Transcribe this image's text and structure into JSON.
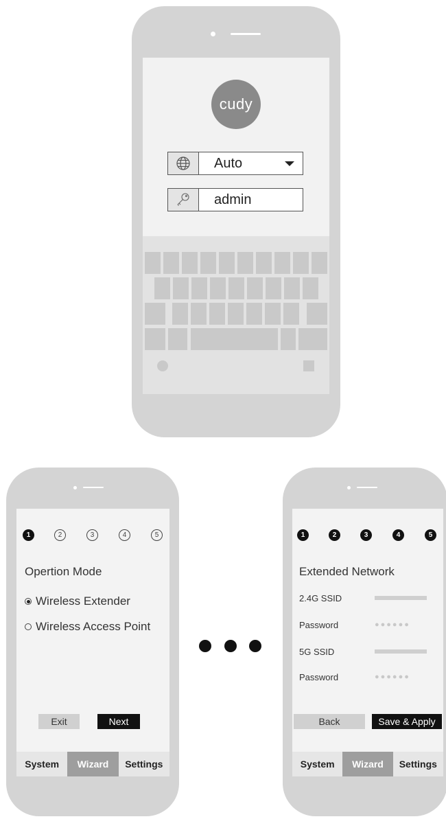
{
  "login_phone": {
    "logo_text": "cudy",
    "language_value": "Auto",
    "password_value": "admin",
    "icons": [
      "globe-icon",
      "key-icon",
      "chevron-down-icon"
    ]
  },
  "wizard_step1": {
    "steps": [
      "1",
      "2",
      "3",
      "4",
      "5"
    ],
    "title": "Opertion Mode",
    "options": [
      "Wireless Extender",
      "Wireless Access Point"
    ],
    "selected_option": "Wireless Extender",
    "exit_label": "Exit",
    "next_label": "Next",
    "tabs": [
      "System",
      "Wizard",
      "Settings"
    ],
    "active_tab": "Wizard"
  },
  "wizard_step5": {
    "steps": [
      "1",
      "2",
      "3",
      "4",
      "5"
    ],
    "title": "Extended Network",
    "fields": [
      "2.4G SSID",
      "Password",
      "5G SSID",
      "Password"
    ],
    "password_mask": "●●●●●●",
    "back_label": "Back",
    "save_label": "Save & Apply",
    "tabs": [
      "System",
      "Wizard",
      "Settings"
    ],
    "active_tab": "Wizard"
  },
  "colors": {
    "phone_body": "#d4d4d4",
    "screen_bg": "#f2f2f2",
    "logo_bg": "#8a8a8a",
    "active_tab": "#9e9e9e",
    "dark_button": "#111111"
  }
}
